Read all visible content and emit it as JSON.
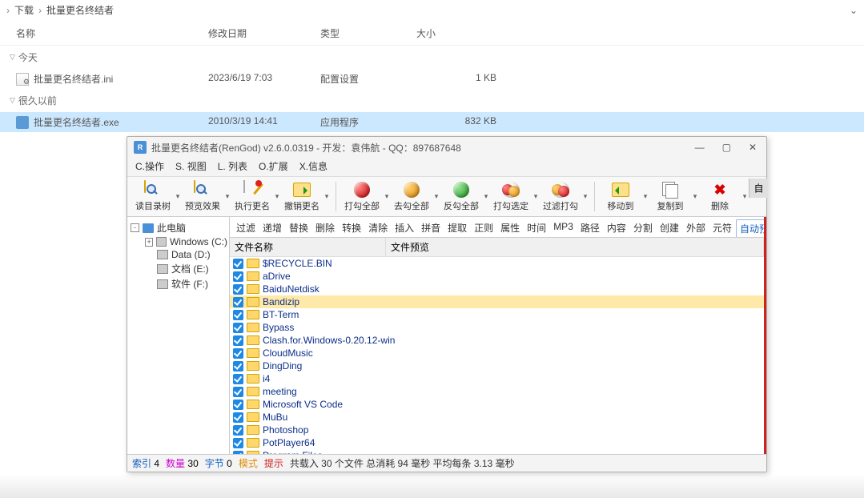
{
  "explorer": {
    "crumbs": [
      "下载",
      "批量更名终结者"
    ],
    "columns": {
      "name": "名称",
      "modified": "修改日期",
      "type": "类型",
      "size": "大小"
    },
    "groups": [
      {
        "label": "今天",
        "rows": [
          {
            "icon": "cfg",
            "name": "批量更名终结者.ini",
            "modified": "2023/6/19 7:03",
            "type": "配置设置",
            "size": "1 KB",
            "selected": false
          }
        ]
      },
      {
        "label": "很久以前",
        "rows": [
          {
            "icon": "exe",
            "name": "批量更名终结者.exe",
            "modified": "2010/3/19 14:41",
            "type": "应用程序",
            "size": "832 KB",
            "selected": true
          }
        ]
      }
    ]
  },
  "app": {
    "title": "批量更名终结者(RenGod) v2.6.0.0319 - 开发：袁伟航 - QQ：897687648",
    "menus": [
      "C.操作",
      "S. 视图",
      "L. 列表",
      "O.扩展",
      "X.信息"
    ],
    "toolbar_groups": [
      [
        {
          "id": "read-tree",
          "label": "读目录树",
          "icon": "mag"
        },
        {
          "id": "preview",
          "label": "预览效果",
          "icon": "mag"
        },
        {
          "id": "do-rename",
          "label": "执行更名",
          "icon": "edit"
        },
        {
          "id": "undo-rename",
          "label": "撤销更名",
          "icon": "arrow-rt"
        }
      ],
      [
        {
          "id": "check-all",
          "label": "打勾全部",
          "icon": "ball-red"
        },
        {
          "id": "uncheck-all",
          "label": "去勾全部",
          "icon": "ball-orange"
        },
        {
          "id": "invert-all",
          "label": "反勾全部",
          "icon": "ball-green"
        },
        {
          "id": "check-sel",
          "label": "打勾选定",
          "icon": "ball-dbl-a"
        },
        {
          "id": "filter-checks",
          "label": "过滤打勾",
          "icon": "ball-dbl-b"
        }
      ],
      [
        {
          "id": "move-to",
          "label": "移动到",
          "icon": "arrow-lt"
        },
        {
          "id": "copy-to",
          "label": "复制到",
          "icon": "copy"
        },
        {
          "id": "delete",
          "label": "删除",
          "icon": "del"
        }
      ]
    ],
    "side_tab": "自",
    "tree": [
      {
        "depth": 1,
        "expand": "-",
        "icon": "pc",
        "label": "此电脑"
      },
      {
        "depth": 2,
        "expand": "+",
        "icon": "drv",
        "label": "Windows (C:)"
      },
      {
        "depth": 2,
        "expand": "",
        "icon": "drv",
        "label": "Data (D:)"
      },
      {
        "depth": 2,
        "expand": "",
        "icon": "drv",
        "label": "文档 (E:)"
      },
      {
        "depth": 2,
        "expand": "",
        "icon": "drv",
        "label": "软件 (F:)"
      }
    ],
    "tabs": [
      "过滤",
      "递增",
      "替换",
      "删除",
      "转换",
      "清除",
      "插入",
      "拼音",
      "提取",
      "正则",
      "属性",
      "时间",
      "MP3",
      "路径",
      "内容",
      "分割",
      "创建",
      "外部",
      "元符",
      "自动预览"
    ],
    "active_tab": "自动预览",
    "list_columns": {
      "name": "文件名称",
      "preview": "文件预览"
    },
    "files": [
      {
        "name": "$RECYCLE.BIN"
      },
      {
        "name": "aDrive"
      },
      {
        "name": "BaiduNetdisk"
      },
      {
        "name": "Bandizip",
        "selected": true
      },
      {
        "name": "BT-Term"
      },
      {
        "name": "Bypass"
      },
      {
        "name": "Clash.for.Windows-0.20.12-win"
      },
      {
        "name": "CloudMusic"
      },
      {
        "name": "DingDing"
      },
      {
        "name": "i4"
      },
      {
        "name": "meeting"
      },
      {
        "name": "Microsoft VS Code"
      },
      {
        "name": "MuBu"
      },
      {
        "name": "Photoshop"
      },
      {
        "name": "PotPlayer64"
      },
      {
        "name": "Program Files"
      }
    ],
    "status": {
      "index_label": "索引",
      "index_value": "4",
      "count_label": "数量",
      "count_value": "30",
      "bytes_label": "字节",
      "bytes_value": "0",
      "mode_label": "模式",
      "tip_label": "提示",
      "message": "共载入 30 个文件   总消耗 94 毫秒   平均每条 3.13 毫秒"
    }
  }
}
